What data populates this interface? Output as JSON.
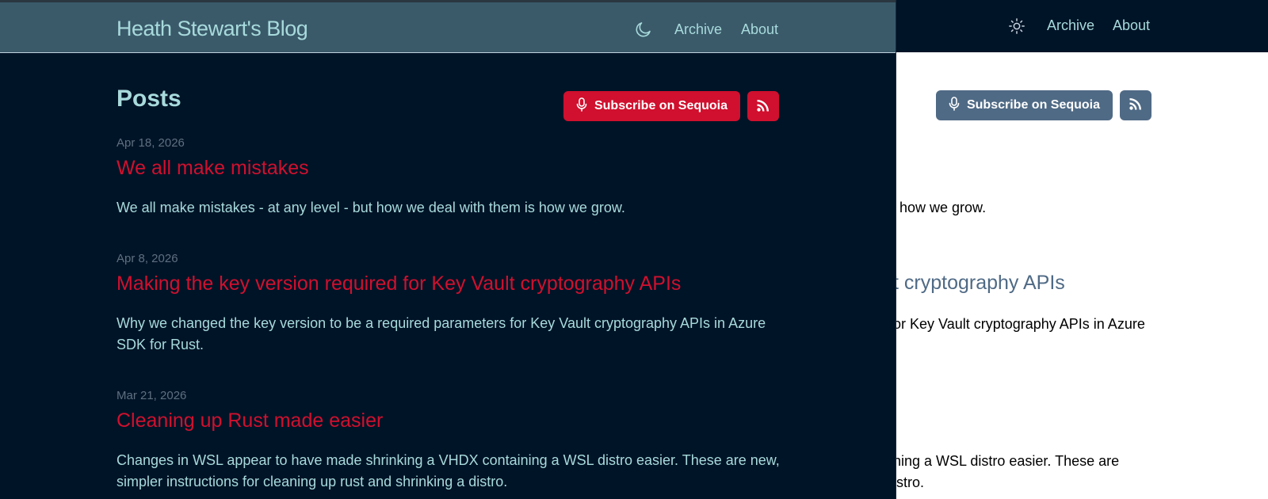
{
  "light": {
    "nav": {
      "archive": "Archive",
      "about": "About"
    },
    "subscribe_label": "Subscribe on Sequoia",
    "fragments": {
      "p1_summary": "n is how we grow.",
      "p2_title": "t cryptography APIs",
      "p2_summary": "or Key Vault cryptography APIs in Azure",
      "p3_summary_1": "ning a WSL distro easier. These are",
      "p3_summary_2": "istro."
    }
  },
  "dark": {
    "brand": "Heath Stewart's Blog",
    "nav": {
      "archive": "Archive",
      "about": "About"
    },
    "heading": "Posts",
    "subscribe_label": "Subscribe on Sequoia",
    "posts": [
      {
        "date": "Apr 18, 2026",
        "title": "We all make mistakes",
        "summary": "We all make mistakes - at any level - but how we deal with them is how we grow."
      },
      {
        "date": "Apr 8, 2026",
        "title": "Making the key version required for Key Vault cryptography APIs",
        "summary": "Why we changed the key version to be a required parameters for Key Vault cryptography APIs in Azure SDK for Rust."
      },
      {
        "date": "Mar 21, 2026",
        "title": "Cleaning up Rust made easier",
        "summary": "Changes in WSL appear to have made shrinking a VHDX containing a WSL distro easier. These are new, simpler instructions for cleaning up rust and shrinking a distro."
      }
    ]
  },
  "colors": {
    "dark_bg": "#001427",
    "accent_red": "#d0102e",
    "teal_text": "#a8dadc",
    "light_button": "#4f6a85"
  },
  "icons": [
    "moon-icon",
    "sun-icon",
    "podcast-icon",
    "rss-icon"
  ]
}
